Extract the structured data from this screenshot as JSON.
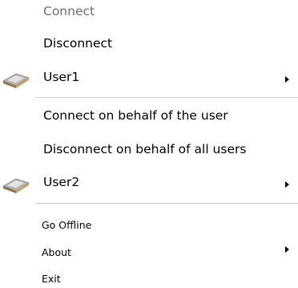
{
  "menu": {
    "items": [
      {
        "label": "Connect",
        "enabled": false
      },
      {
        "label": "Disconnect",
        "enabled": true
      },
      {
        "label": "User1",
        "enabled": true,
        "icon": "user-card-icon",
        "submenu": true
      },
      {
        "label": "Connect on behalf of the user",
        "enabled": true
      },
      {
        "label": "Disconnect on behalf of all users",
        "enabled": true
      },
      {
        "label": "User2",
        "enabled": true,
        "icon": "user-card-icon",
        "submenu": true
      },
      {
        "label": "Go Offline",
        "enabled": true
      },
      {
        "label": "About",
        "enabled": true,
        "submenu": true
      },
      {
        "label": "Exit",
        "enabled": true
      }
    ]
  },
  "colors": {
    "background": "#ffffff",
    "text": "#000000",
    "disabled_text": "#6d6d6d",
    "separator": "#cfcfcf"
  }
}
